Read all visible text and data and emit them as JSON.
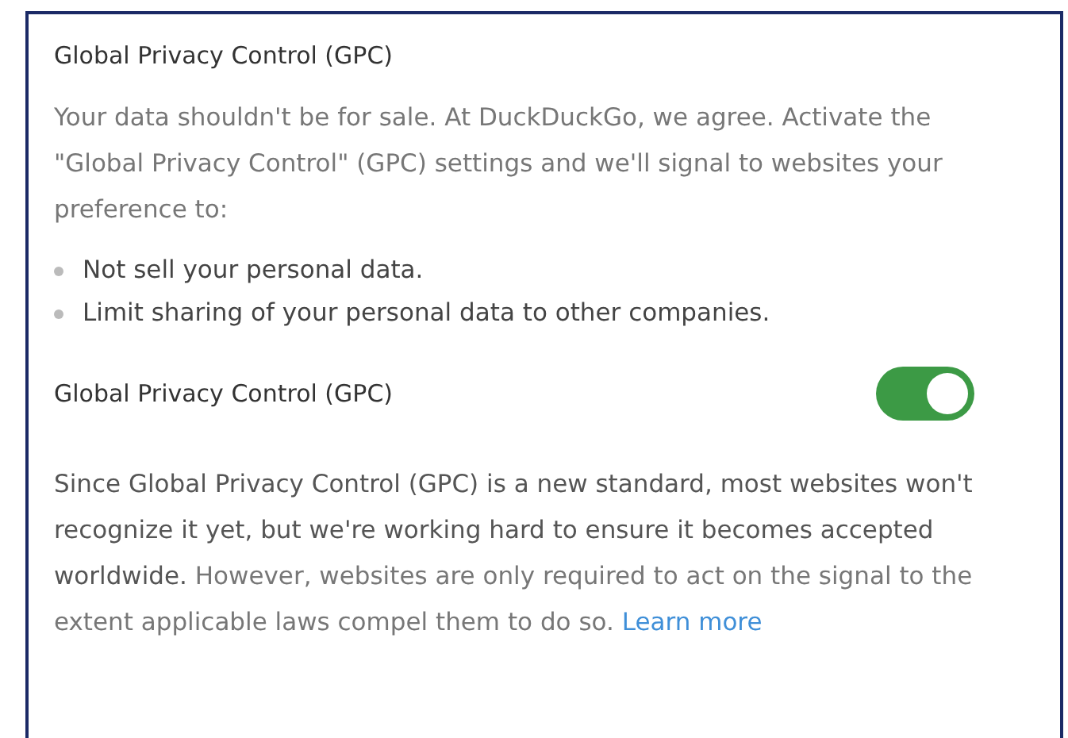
{
  "section_title": "Global Privacy Control (GPC)",
  "intro": "Your data shouldn't be for sale. At DuckDuckGo, we agree. Activate the \"Global Privacy Control\" (GPC) settings and we'll signal to websites your preference to:",
  "bullets": [
    "Not sell your personal data.",
    "Limit sharing of your personal data to other companies."
  ],
  "setting": {
    "label": "Global Privacy Control (GPC)",
    "on": true
  },
  "note": {
    "text": "**Since Global Privacy Control (GPC) is a new standard, most websites won't recognize it yet, but we're working hard to ensure it becomes accepted worldwide.** However, websites are only required to act on the signal to the extent applicable laws compel them to do so.",
    "link": "Learn more"
  }
}
